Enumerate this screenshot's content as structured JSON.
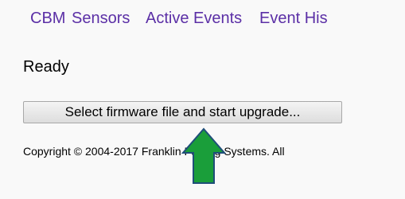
{
  "nav": {
    "items": [
      {
        "label": "CBM"
      },
      {
        "label": "Sensors"
      },
      {
        "label": "Active Events"
      },
      {
        "label": "Event His"
      }
    ]
  },
  "status": {
    "text": "Ready"
  },
  "upgrade": {
    "button_label": "Select firmware file and start upgrade..."
  },
  "footer": {
    "copyright": "Copyright © 2004-2017 Franklin Fueling Systems. All"
  },
  "annotation": {
    "icon": "up-arrow-icon",
    "fill_color": "#1a9e3a",
    "stroke_color": "#1f4e79"
  }
}
